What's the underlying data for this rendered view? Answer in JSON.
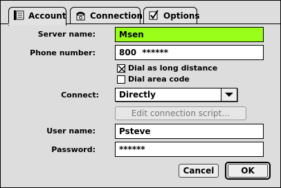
{
  "tabs": [
    {
      "label": "Account",
      "icon": "account-book-icon",
      "active": true
    },
    {
      "label": "Connection",
      "icon": "telephone-icon",
      "active": false
    },
    {
      "label": "Options",
      "icon": "checkmark-box-icon",
      "active": false
    }
  ],
  "form": {
    "server_name": {
      "label": "Server name:",
      "value": "Msen"
    },
    "phone_number": {
      "label": "Phone number:",
      "value": "800  ******"
    },
    "dial_long_distance": {
      "label": "Dial as long distance",
      "checked": true
    },
    "dial_area_code": {
      "label": "Dial area code",
      "checked": false
    },
    "connect": {
      "label": "Connect:",
      "selected": "Directly"
    },
    "edit_script": {
      "label": "Edit connection script…"
    },
    "user_name": {
      "label": "User name:",
      "value": "Psteve"
    },
    "password": {
      "label": "Password:",
      "value": "******"
    }
  },
  "buttons": {
    "cancel": "Cancel",
    "ok": "OK"
  },
  "colors": {
    "highlight": "#99ff1a",
    "panel": "#dddddd"
  }
}
